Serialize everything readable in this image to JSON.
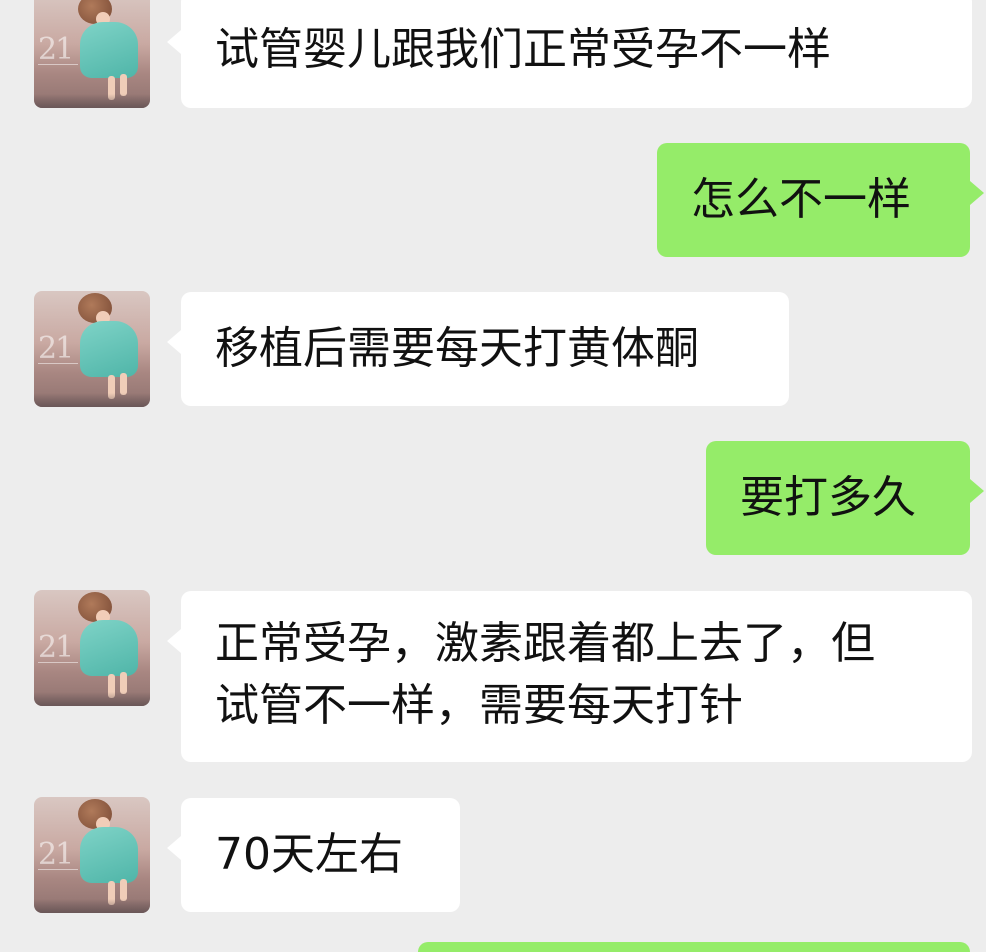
{
  "chat": {
    "messages": [
      {
        "direction": "in",
        "text": "试管婴儿跟我们正常受孕不一样"
      },
      {
        "direction": "out",
        "text": "怎么不一样"
      },
      {
        "direction": "in",
        "text": "移植后需要每天打黄体酮"
      },
      {
        "direction": "out",
        "text": "要打多久"
      },
      {
        "direction": "in",
        "lines": [
          "正常受孕，激素跟着都上去了，但",
          "试管不一样，需要每天打针"
        ]
      },
      {
        "direction": "in",
        "text": "70天左右"
      }
    ],
    "avatar": {
      "label": "21",
      "icon": "girl-in-teal-dress-avatar"
    }
  }
}
